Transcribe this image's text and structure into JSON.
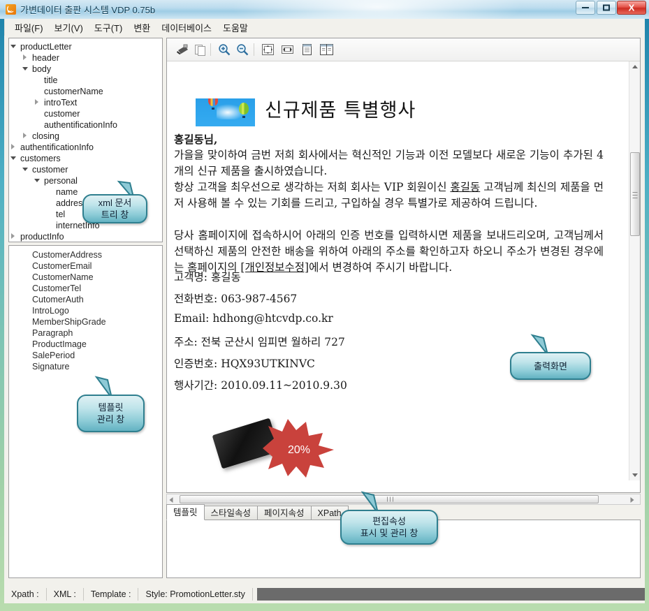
{
  "window": {
    "title": "가변데이터 출판 시스템 VDP 0.75b",
    "app_icon": "rss-feed-icon",
    "controls": {
      "minimize": "–",
      "maximize": "□",
      "close": "X"
    }
  },
  "menu": {
    "items": [
      {
        "label": "파일(F)",
        "name": "menu-file"
      },
      {
        "label": "보기(V)",
        "name": "menu-view"
      },
      {
        "label": "도구(T)",
        "name": "menu-tools"
      },
      {
        "label": "변환",
        "name": "menu-convert"
      },
      {
        "label": "데이터베이스",
        "name": "menu-database"
      },
      {
        "label": "도움말",
        "name": "menu-help"
      }
    ]
  },
  "xml_tree": {
    "nodes": [
      {
        "label": "productLetter",
        "depth": 0,
        "state": "expanded"
      },
      {
        "label": "header",
        "depth": 1,
        "state": "collapsed"
      },
      {
        "label": "body",
        "depth": 1,
        "state": "expanded"
      },
      {
        "label": "title",
        "depth": 2,
        "state": "leaf"
      },
      {
        "label": "customerName",
        "depth": 2,
        "state": "leaf"
      },
      {
        "label": "introText",
        "depth": 2,
        "state": "collapsed"
      },
      {
        "label": "customer",
        "depth": 2,
        "state": "leaf"
      },
      {
        "label": "authentificationInfo",
        "depth": 2,
        "state": "leaf"
      },
      {
        "label": "closing",
        "depth": 1,
        "state": "collapsed"
      },
      {
        "label": "authentificationInfo",
        "depth": 0,
        "state": "collapsed"
      },
      {
        "label": "customers",
        "depth": 0,
        "state": "expanded"
      },
      {
        "label": "customer",
        "depth": 1,
        "state": "expanded"
      },
      {
        "label": "personal",
        "depth": 2,
        "state": "expanded"
      },
      {
        "label": "name",
        "depth": 3,
        "state": "leaf"
      },
      {
        "label": "address",
        "depth": 3,
        "state": "leaf"
      },
      {
        "label": "tel",
        "depth": 3,
        "state": "leaf"
      },
      {
        "label": "internetInfo",
        "depth": 3,
        "state": "leaf"
      },
      {
        "label": "productInfo",
        "depth": 0,
        "state": "collapsed"
      }
    ]
  },
  "template_list": {
    "items": [
      "CustomerAddress",
      "CustomerEmail",
      "CustomerName",
      "CustomerTel",
      "CutomerAuth",
      "IntroLogo",
      "MemberShipGrade",
      "Paragraph",
      "ProductImage",
      "SalePeriod",
      "Signature"
    ]
  },
  "toolbar": {
    "buttons": [
      {
        "name": "print-icon",
        "title": "인쇄"
      },
      {
        "name": "copy-page-icon",
        "title": "복사"
      },
      {
        "name": "zoom-in-icon",
        "title": "확대"
      },
      {
        "name": "zoom-out-icon",
        "title": "축소"
      },
      {
        "name": "fit-page-icon",
        "title": "페이지 맞춤"
      },
      {
        "name": "fit-width-icon",
        "title": "너비 맞춤"
      },
      {
        "name": "single-page-icon",
        "title": "한 페이지"
      },
      {
        "name": "two-page-icon",
        "title": "두 페이지"
      }
    ]
  },
  "document": {
    "title": "신규제품  특별행사",
    "salutation": "홍길동님,",
    "paragraph1": "가을을 맞이하여 금번 저희 회사에서는 혁신적인 기능과 이전 모델보다 새로운 기능이 추가된 4개의 신규 제품을 출시하였습니다.",
    "paragraph2_a": "항상 고객을 최우선으로 생각하는 저희 회사는 VIP 회원이신 ",
    "paragraph2_name": "홍길동",
    "paragraph2_b": " 고객님께 최신의 제품을 먼저 사용해 볼 수 있는 기회를 드리고, 구입하실 경우 특별가로 제공하여 드립니다.",
    "paragraph3_a": "당사 홈페이지에 접속하시어 아래의 인증 번호를 입력하시면 제품을 보내드리오며, 고객님께서 선택하신 제품의 안전한 배송을 위하여 아래의 주소를 확인하고자 하오니 주소가 변경된 경우에는 홈페이지의 ",
    "paragraph3_link": "[개인정보수정]",
    "paragraph3_b": "에서 변경하여 주시기 바랍니다.",
    "fields": [
      {
        "label": "고객명:",
        "value": "홍길동"
      },
      {
        "label": "전화번호:",
        "value": "063-987-4567"
      },
      {
        "label": "Email:",
        "value": "hdhong@htcvdp.co.kr"
      },
      {
        "label": "주소:",
        "value": "전북 군산시 임피면 월하리 727"
      },
      {
        "label": "인증번호:",
        "value": "HQX93UTKINVC"
      },
      {
        "label": "행사기간:",
        "value": "2010.09.11~2010.9.30"
      }
    ],
    "discount_badge": "20%"
  },
  "property_tabs": {
    "tabs": [
      "템플릿",
      "스타일속성",
      "페이지속성",
      "XPath"
    ],
    "active_index": 0
  },
  "status_bar": {
    "cells": [
      "Xpath :",
      "XML :",
      "Template :",
      "Style: PromotionLetter.sty"
    ]
  },
  "callouts": [
    {
      "name": "callout-xml-tree",
      "lines": [
        "xml 문서",
        "트리 창"
      ]
    },
    {
      "name": "callout-template",
      "lines": [
        "템플릿",
        "관리 창"
      ]
    },
    {
      "name": "callout-output",
      "lines": [
        "출력화면"
      ]
    },
    {
      "name": "callout-properties",
      "lines": [
        "편집속성",
        "표시 및 관리 창"
      ]
    }
  ],
  "colors": {
    "frame": "#2e93b5",
    "callout_border": "#2f7f8f",
    "burst": "#c9423c",
    "status_filler": "#6b6b6b"
  }
}
